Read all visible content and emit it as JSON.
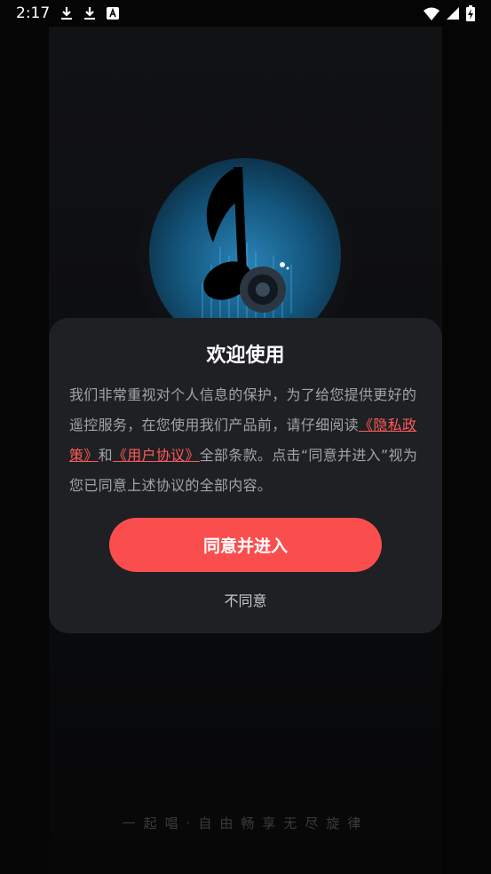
{
  "status_bar": {
    "time": "2:17",
    "icons": [
      "download-icon",
      "download-icon",
      "a-icon",
      "wifi-icon",
      "signal-icon",
      "battery-charging-icon"
    ]
  },
  "dialog": {
    "title": "欢迎使用",
    "body_prefix": "我们非常重视对个人信息的保护，为了给您提供更好的遥控服务，在您使用我们产品前，请仔细阅读",
    "privacy_link": "《隐私政策》",
    "and_text": "和",
    "agreement_link": "《用户协议》",
    "body_suffix": "全部条款。点击“同意并进入”视为您已同意上述协议的全部内容。",
    "agree_label": "同意并进入",
    "disagree_label": "不同意"
  },
  "slogan": "一起唱·自由畅享无尽旋律",
  "colors": {
    "accent": "#fa4e4e",
    "link": "#ff5a5a",
    "dialog_bg": "#1f2023"
  }
}
